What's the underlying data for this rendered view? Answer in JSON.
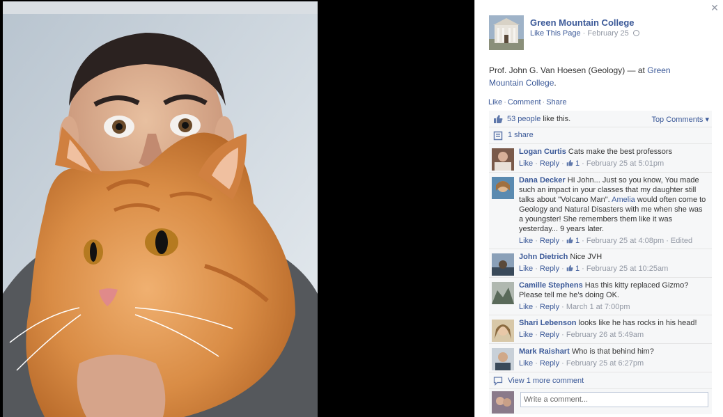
{
  "page": {
    "name": "Green Mountain College",
    "like_page": "Like This Page",
    "date": "February 25"
  },
  "post": {
    "caption_text": "Prof. John G. Van Hoesen (Geology) — at ",
    "caption_place": "Green Mountain College",
    "caption_end": "."
  },
  "actions": {
    "like": "Like",
    "comment": "Comment",
    "share": "Share"
  },
  "likes": {
    "count_link": "53 people",
    "suffix": " like this.",
    "top_comments": "Top Comments ▾"
  },
  "shares": {
    "label": "1 share"
  },
  "comments": [
    {
      "author": "Logan Curtis",
      "text": "Cats make the best professors",
      "like": "Like",
      "reply": "Reply",
      "likes": "1",
      "time": "February 25 at 5:01pm",
      "avatar_color": "#7a5a4a"
    },
    {
      "author": "Dana Decker",
      "text_a": "HI John... Just so you know, You made such an impact in your classes that my daughter still talks about \"Volcano Man\". ",
      "mention": "Amelia",
      "text_b": " would often come to Geology and Natural Disasters with me when she was a youngster! She remembers them like it was yesterday... 9 years later.",
      "like": "Like",
      "reply": "Reply",
      "likes": "1",
      "time": "February 25 at 4:08pm",
      "edited": "Edited",
      "avatar_color": "#5a8ab0"
    },
    {
      "author": "John Dietrich",
      "text": "Nice JVH",
      "like": "Like",
      "reply": "Reply",
      "likes": "1",
      "time": "February 25 at 10:25am",
      "avatar_color": "#4a5a6a"
    },
    {
      "author": "Camille Stephens",
      "text": "Has this kitty replaced Gizmo? Please tell me he's doing OK.",
      "like": "Like",
      "reply": "Reply",
      "time": "March 1 at 7:00pm",
      "avatar_color": "#6a7a6a"
    },
    {
      "author": "Shari Lebenson",
      "text": "looks like he has rocks in his head!",
      "like": "Like",
      "reply": "Reply",
      "time": "February 26 at 5:49am",
      "avatar_color": "#b09060"
    },
    {
      "author": "Mark Raishart",
      "text": "Who is that behind him?",
      "like": "Like",
      "reply": "Reply",
      "time": "February 25 at 6:27pm",
      "avatar_color": "#3a4a5a"
    }
  ],
  "more_comments": "View 1 more comment",
  "write": {
    "placeholder": "Write a comment..."
  },
  "colors": {
    "link": "#3b5998",
    "muted": "#9197a3",
    "ufi_bg": "#f6f7f8"
  }
}
